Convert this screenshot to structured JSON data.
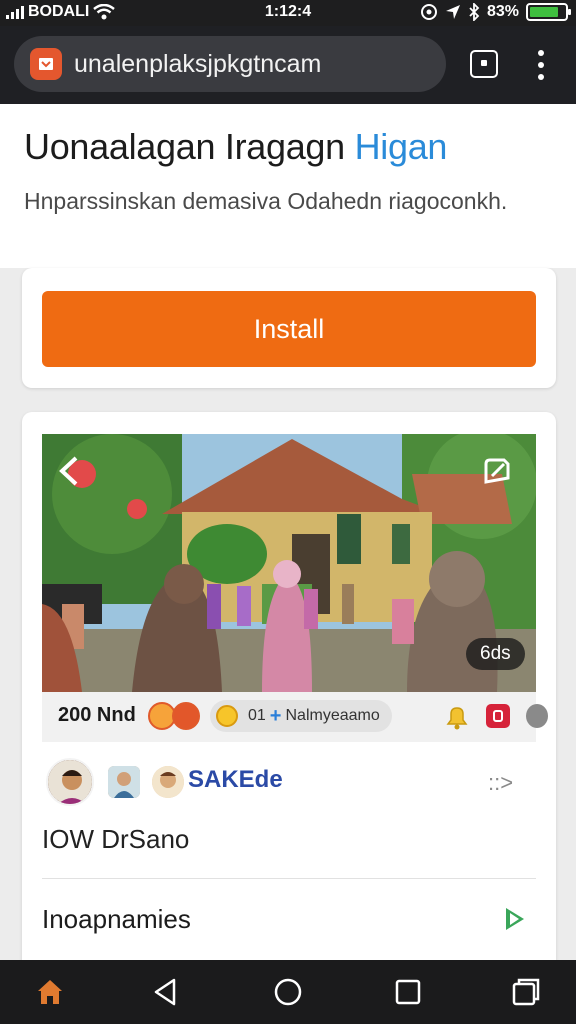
{
  "status_bar": {
    "carrier": "BODALI",
    "time": "1:12:4",
    "battery": "83%",
    "battery_level": 0.83,
    "icons": [
      "signal-icon",
      "wifi-icon",
      "alarm-icon",
      "location-icon",
      "bluetooth-icon",
      "battery-icon"
    ]
  },
  "browser": {
    "url": "unalenplaksjpkgtncam",
    "icons": [
      "site-favicon-icon",
      "tab-switcher-icon",
      "more-menu-icon"
    ]
  },
  "header": {
    "title": "Uonaalagan Iragagn",
    "title_accent": "Higan",
    "subtitle": "Hnparssinskan demasiva Odahedn riagoconkh."
  },
  "install": {
    "label": "Install"
  },
  "post": {
    "media_count": "6ds",
    "price": "200 Nnd",
    "chip_count": "01",
    "chip_label": "Nalmyeaamo",
    "username": "SAKEde",
    "share_label": "::>",
    "caption": "IOW DrSano",
    "row_label": "Inoapnamies"
  },
  "colors": {
    "accent_orange": "#ef6b12",
    "link_blue": "#2a8bd9",
    "username_blue": "#2b4aa6",
    "play_green": "#3aa65a"
  },
  "navbar": {
    "icons": [
      "home-icon",
      "back-icon",
      "home-circle-icon",
      "recents-icon",
      "tabs-icon"
    ]
  }
}
